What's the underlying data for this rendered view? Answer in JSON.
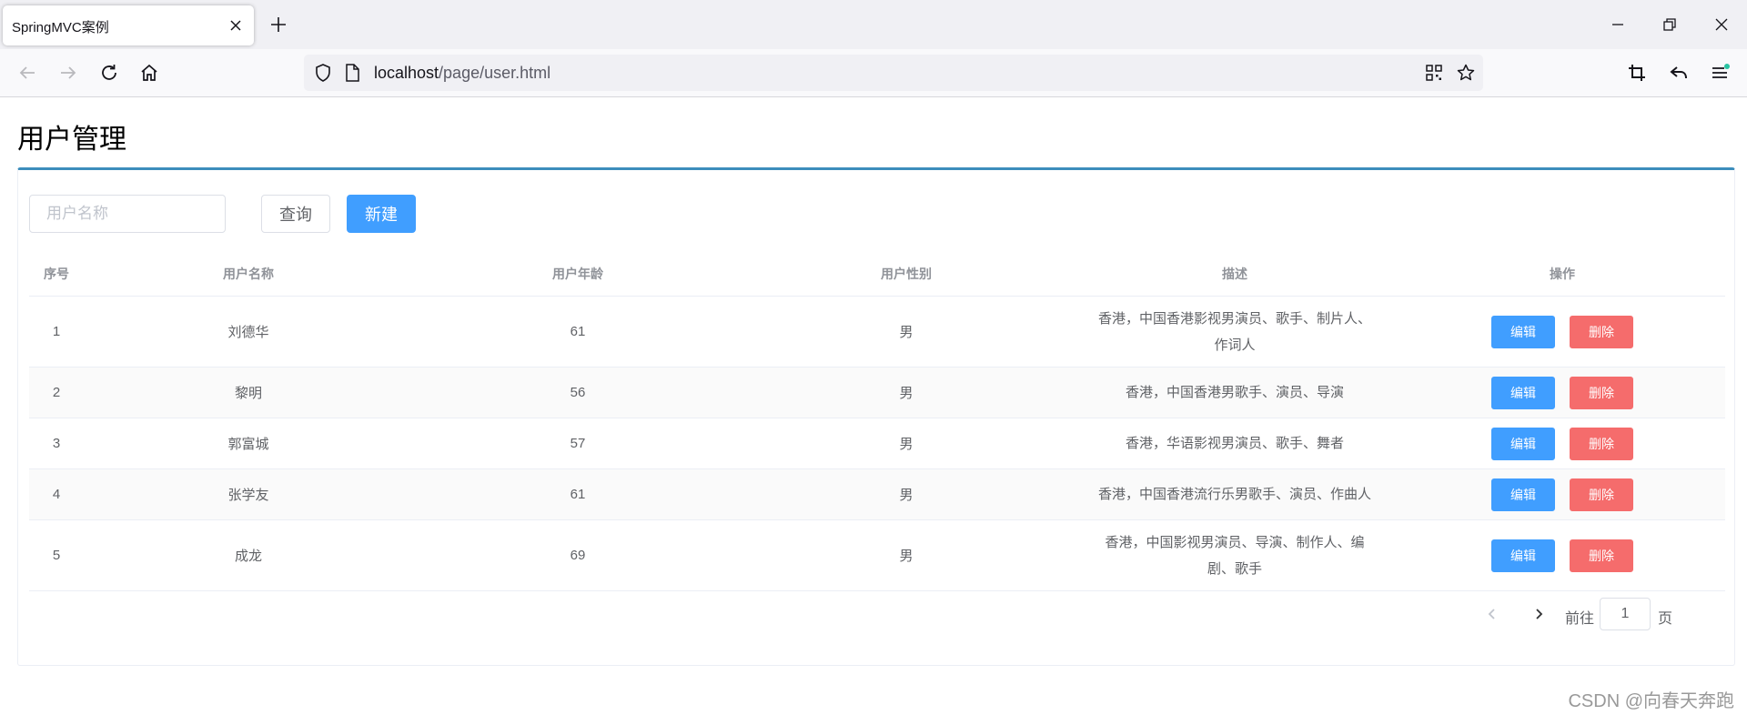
{
  "browser": {
    "tab_title": "SpringMVC案例",
    "url_host": "localhost",
    "url_path": "/page/user.html"
  },
  "page": {
    "title": "用户管理",
    "search_placeholder": "用户名称",
    "query_label": "查询",
    "new_label": "新建"
  },
  "table": {
    "headers": {
      "index": "序号",
      "name": "用户名称",
      "age": "用户年龄",
      "gender": "用户性别",
      "desc": "描述",
      "actions": "操作"
    },
    "edit_label": "编辑",
    "delete_label": "删除",
    "rows": [
      {
        "index": "1",
        "name": "刘德华",
        "age": "61",
        "gender": "男",
        "desc": "香港，中国香港影视男演员、歌手、制片人、作词人"
      },
      {
        "index": "2",
        "name": "黎明",
        "age": "56",
        "gender": "男",
        "desc": "香港，中国香港男歌手、演员、导演"
      },
      {
        "index": "3",
        "name": "郭富城",
        "age": "57",
        "gender": "男",
        "desc": "香港，华语影视男演员、歌手、舞者"
      },
      {
        "index": "4",
        "name": "张学友",
        "age": "61",
        "gender": "男",
        "desc": "香港，中国香港流行乐男歌手、演员、作曲人"
      },
      {
        "index": "5",
        "name": "成龙",
        "age": "69",
        "gender": "男",
        "desc": "香港，中国影视男演员、导演、制作人、编剧、歌手"
      }
    ]
  },
  "pagination": {
    "goto_label": "前往",
    "page_value": "1",
    "page_suffix": "页"
  },
  "watermark": "CSDN @向春天奔跑",
  "colors": {
    "primary": "#409eff",
    "danger": "#f56c6c",
    "card_accent": "#3c8dbc"
  }
}
